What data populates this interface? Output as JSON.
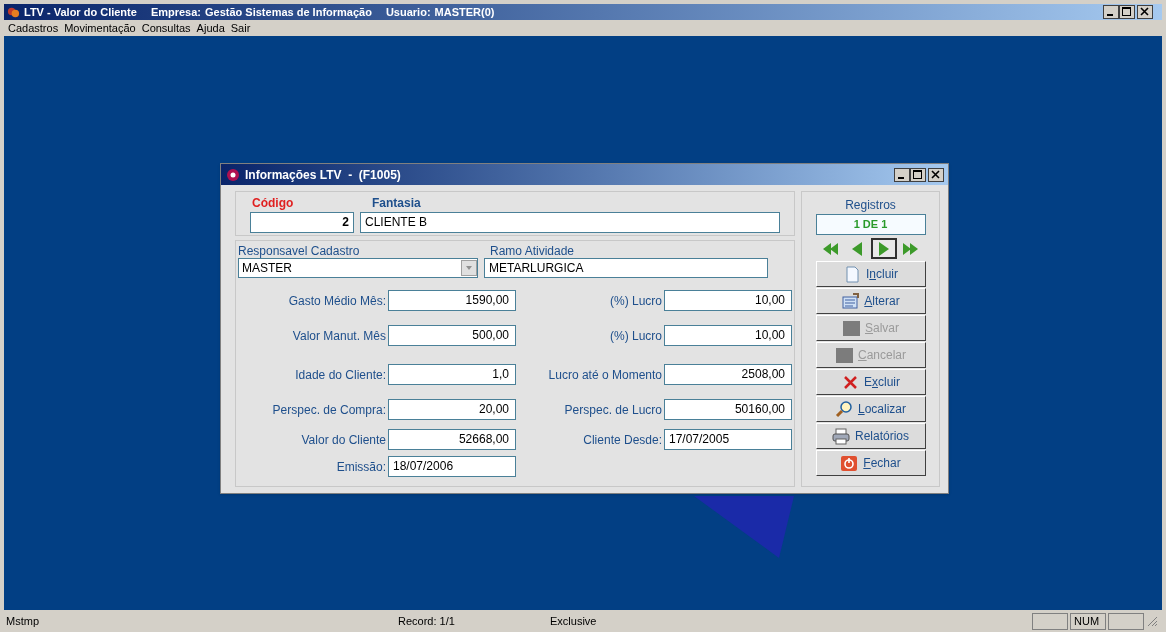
{
  "app": {
    "title": "LTV - Valor do Cliente",
    "company_label": "Empresa:",
    "company": "Gestão Sistemas de Informação",
    "user_label": "Usuario:",
    "user": "MASTER(0)"
  },
  "menu": [
    "Cadastros",
    "Movimentação",
    "Consultas",
    "Ajuda",
    "Sair"
  ],
  "dialog": {
    "title": "Informações LTV  -  (F1005)",
    "codigo": {
      "label": "Código",
      "value": "2"
    },
    "fantasia": {
      "label": "Fantasia",
      "value": "CLIENTE B"
    },
    "responsavel": {
      "label": "Responsavel Cadastro",
      "value": "MASTER"
    },
    "ramo": {
      "label": "Ramo Atividade",
      "value": "METARLURGICA"
    },
    "rows": [
      {
        "left": {
          "label": "Gasto Médio Mês:",
          "value": "1590,00",
          "kind": "number"
        },
        "right": {
          "label": "(%) Lucro",
          "value": "10,00",
          "kind": "number"
        }
      },
      {
        "left": {
          "label": "Valor Manut. Mês",
          "value": "500,00",
          "kind": "number"
        },
        "right": {
          "label": "(%) Lucro",
          "value": "10,00",
          "kind": "number"
        }
      },
      {
        "left": {
          "label": "Idade do Cliente:",
          "value": "1,0",
          "kind": "number"
        },
        "right": {
          "label": "Lucro até o Momento",
          "value": "2508,00",
          "kind": "number"
        }
      },
      {
        "left": {
          "label": "Perspec. de Compra:",
          "value": "20,00",
          "kind": "number"
        },
        "right": {
          "label": "Perspec. de Lucro",
          "value": "50160,00",
          "kind": "number"
        }
      },
      {
        "left": {
          "label": "Valor do Cliente",
          "value": "52668,00",
          "kind": "number"
        },
        "right": {
          "label": "Cliente Desde:",
          "value": "17/07/2005",
          "kind": "date"
        }
      },
      {
        "left": {
          "label": "Emissão:",
          "value": "18/07/2006",
          "kind": "date"
        }
      }
    ],
    "registros": {
      "label": "Registros",
      "value": "1 DE 1"
    },
    "nav": [
      {
        "kind": "first",
        "selected": false
      },
      {
        "kind": "prev",
        "selected": false
      },
      {
        "kind": "next",
        "selected": true
      },
      {
        "kind": "last",
        "selected": false
      }
    ],
    "buttons": [
      {
        "kind": "new",
        "pre": "I",
        "key": "n",
        "post": "cluir",
        "disabled": false
      },
      {
        "kind": "edit",
        "key": "A",
        "post": "lterar",
        "disabled": false
      },
      {
        "kind": "save",
        "key": "S",
        "post": "alvar",
        "disabled": true
      },
      {
        "kind": "cancel",
        "key": "C",
        "post": "ancelar",
        "disabled": true
      },
      {
        "kind": "delete",
        "pre": "E",
        "key": "x",
        "post": "cluir",
        "disabled": false
      },
      {
        "kind": "find",
        "key": "L",
        "post": "ocalizar",
        "disabled": false
      },
      {
        "kind": "report",
        "pre": "Relatórios",
        "disabled": false
      },
      {
        "kind": "close",
        "key": "F",
        "post": "echar",
        "disabled": false
      }
    ]
  },
  "status_bar": {
    "left": "Mstmp",
    "record": "Record: 1/1",
    "mode": "Exclusive",
    "num": "NUM"
  }
}
